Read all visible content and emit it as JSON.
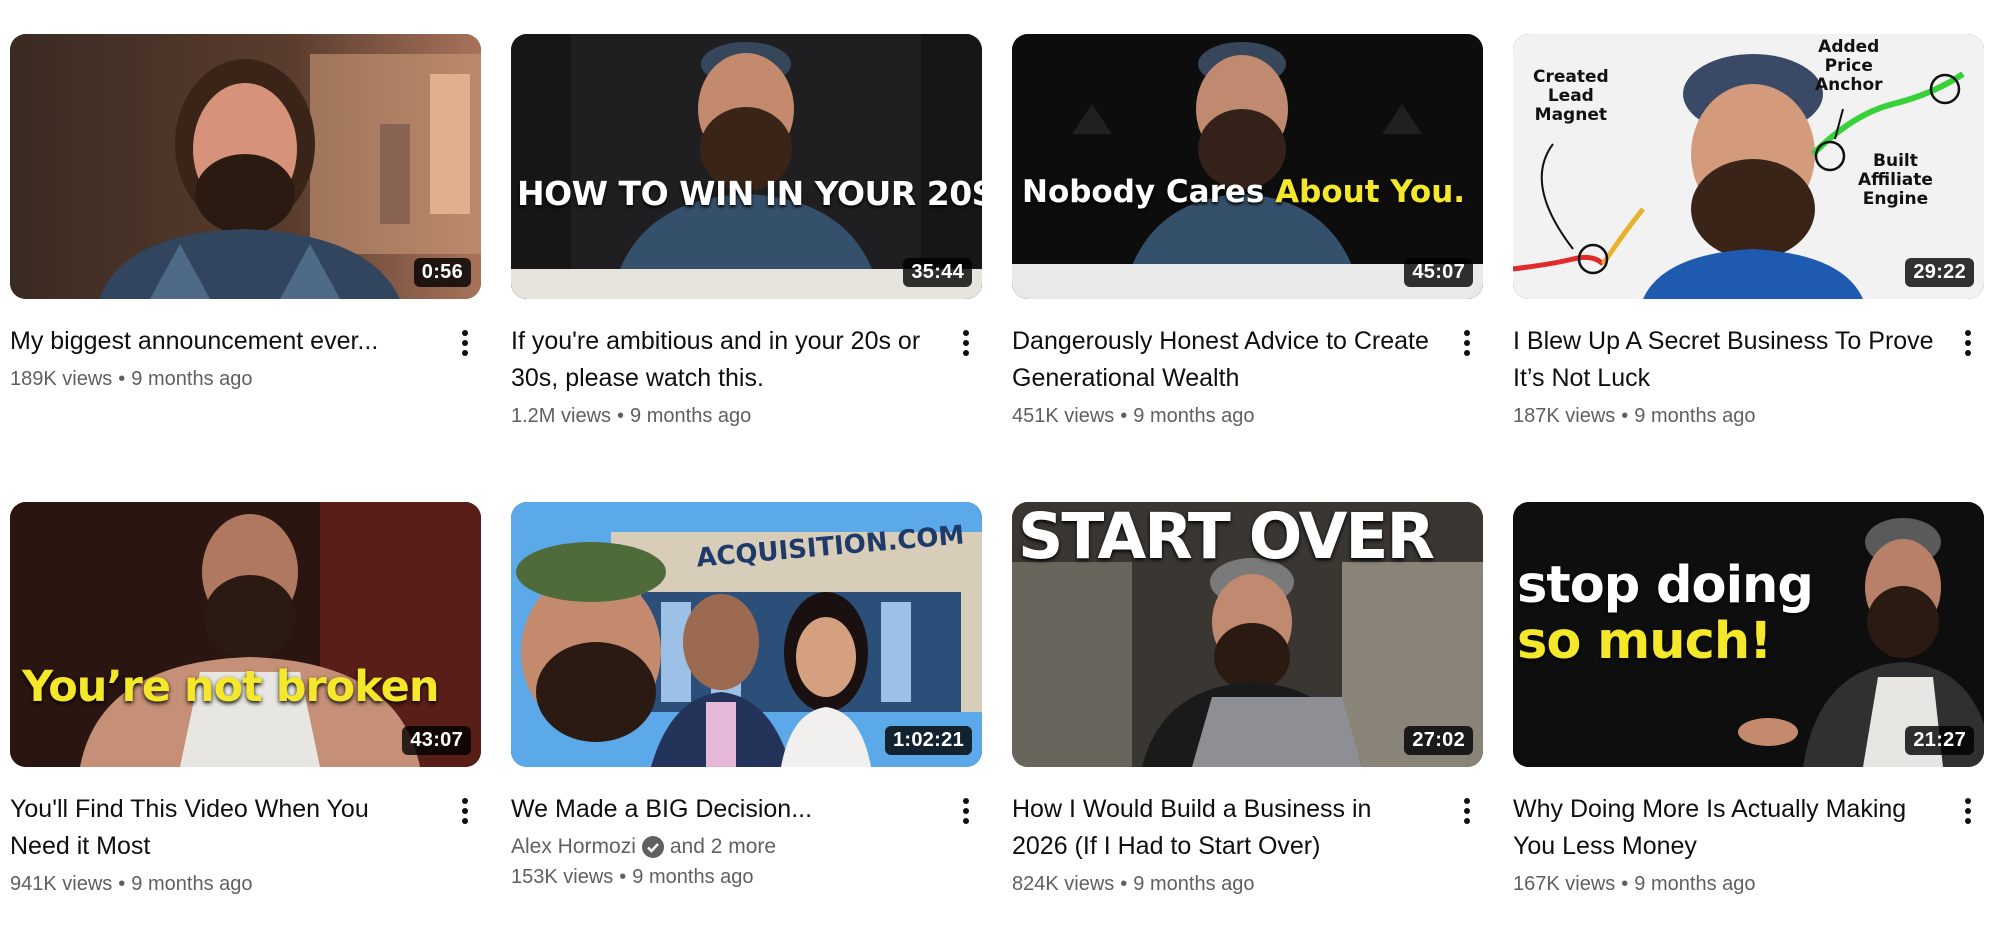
{
  "videos": [
    {
      "title": "My biggest announcement ever...",
      "duration": "0:56",
      "views": "189K views",
      "age": "9 months ago",
      "thumb_text": ""
    },
    {
      "title": "If you're ambitious and in your 20s or 30s, please watch this.",
      "duration": "35:44",
      "views": "1.2M views",
      "age": "9 months ago",
      "thumb_text": "HOW TO WIN IN YOUR 20S"
    },
    {
      "title": "Dangerously Honest Advice to Create Generational Wealth",
      "duration": "45:07",
      "views": "451K views",
      "age": "9 months ago",
      "thumb_text_a": "Nobody Cares",
      "thumb_text_b": "About You."
    },
    {
      "title": "I Blew Up A Secret Business To Prove It’s Not Luck",
      "duration": "29:22",
      "views": "187K views",
      "age": "9 months ago",
      "thumb_notes": [
        "Created",
        "Lead",
        "Magnet",
        "Added",
        "Price",
        "Anchor",
        "Built",
        "Affiliate",
        "Engine"
      ]
    },
    {
      "title": "You'll Find This Video When You Need it Most",
      "duration": "43:07",
      "views": "941K views",
      "age": "9 months ago",
      "thumb_text": "You’re not broken"
    },
    {
      "title": "We Made a BIG Decision...",
      "duration": "1:02:21",
      "views": "153K views",
      "age": "9 months ago",
      "channel": "Alex Hormozi",
      "channel_extra": "and 2 more",
      "thumb_text": "ACQUISITION.COM"
    },
    {
      "title": "How I Would Build a Business in 2026 (If I Had to Start Over)",
      "duration": "27:02",
      "views": "824K views",
      "age": "9 months ago",
      "thumb_text": "START OVER"
    },
    {
      "title": "Why Doing More Is Actually Making You Less Money",
      "duration": "21:27",
      "views": "167K views",
      "age": "9 months ago",
      "thumb_text_a": "stop doing",
      "thumb_text_b": "so much!"
    }
  ],
  "meta_separator": "•",
  "colors": {
    "title": "#0f0f0f",
    "meta": "#606060",
    "yellow": "#f5e82a"
  },
  "icons": {
    "more": "kebab-menu-icon",
    "verified": "verified-check-icon"
  }
}
